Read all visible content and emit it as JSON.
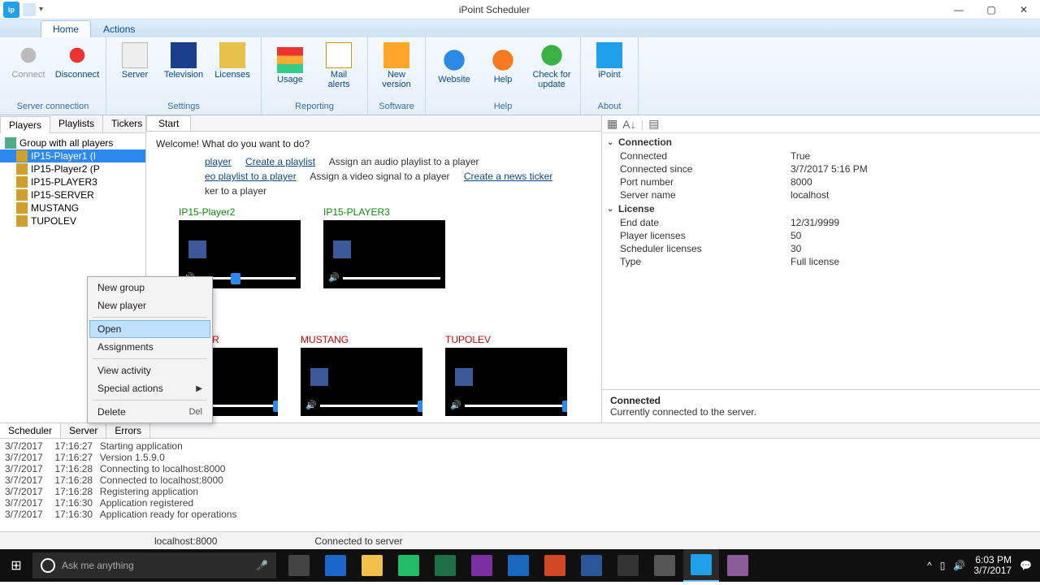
{
  "window": {
    "title": "iPoint Scheduler"
  },
  "tabs": {
    "home": "Home",
    "actions": "Actions"
  },
  "ribbon": {
    "groups": {
      "server_connection": {
        "label": "Server connection",
        "connect": "Connect",
        "disconnect": "Disconnect"
      },
      "settings": {
        "label": "Settings",
        "server": "Server",
        "television": "Television",
        "licenses": "Licenses"
      },
      "reporting": {
        "label": "Reporting",
        "usage": "Usage",
        "mail_alerts": "Mail\nalerts"
      },
      "software": {
        "label": "Software",
        "new_version": "New\nversion"
      },
      "help": {
        "label": "Help",
        "website": "Website",
        "help": "Help",
        "check_update": "Check for\nupdate"
      },
      "about": {
        "label": "About",
        "ipoint": "iPoint"
      }
    }
  },
  "left_tabs": {
    "players": "Players",
    "playlists": "Playlists",
    "tickers": "Tickers"
  },
  "tree": {
    "root": "Group with all players",
    "items": [
      "IP15-Player1 (I",
      "IP15-Player2 (P",
      "IP15-PLAYER3",
      "IP15-SERVER",
      "MUSTANG",
      "TUPOLEV"
    ]
  },
  "center_tab": "Start",
  "welcome": {
    "heading": "Welcome! What do you want to do?",
    "row1": {
      "link1": "player",
      "link2": "Create a playlist",
      "text3": "Assign an audio playlist to a player"
    },
    "row2": {
      "link1": "eo playlist to a player",
      "text2": "Assign a video signal to a player",
      "link3": "Create a news ticker"
    },
    "row3": {
      "text1": "ker to a player"
    }
  },
  "thumbs": [
    {
      "name": "IP15-Player2",
      "cls": "green",
      "knob": 40
    },
    {
      "name": "IP15-PLAYER3",
      "cls": "green",
      "knob": 130
    },
    {
      "name": "IP15-SERVER",
      "cls": "red",
      "knob": 120
    },
    {
      "name": "MUSTANG",
      "cls": "red",
      "knob": 120
    },
    {
      "name": "TUPOLEV",
      "cls": "red",
      "knob": 120
    }
  ],
  "context_menu": {
    "new_group": "New group",
    "new_player": "New player",
    "open": "Open",
    "assignments": "Assignments",
    "view_activity": "View activity",
    "special_actions": "Special actions",
    "delete": "Delete",
    "delete_sc": "Del"
  },
  "properties": {
    "toolbar_hint": "",
    "connection": {
      "cat": "Connection",
      "connected": {
        "k": "Connected",
        "v": "True"
      },
      "connected_since": {
        "k": "Connected since",
        "v": "3/7/2017 5:16 PM"
      },
      "port": {
        "k": "Port number",
        "v": "8000"
      },
      "server_name": {
        "k": "Server name",
        "v": "localhost"
      }
    },
    "license": {
      "cat": "License",
      "end_date": {
        "k": "End date",
        "v": "12/31/9999"
      },
      "player_licenses": {
        "k": "Player licenses",
        "v": "50"
      },
      "scheduler_licenses": {
        "k": "Scheduler licenses",
        "v": "30"
      },
      "type": {
        "k": "Type",
        "v": "Full license"
      }
    }
  },
  "right_status": {
    "title": "Connected",
    "msg": "Currently connected to the server."
  },
  "log_tabs": {
    "scheduler": "Scheduler",
    "server": "Server",
    "errors": "Errors"
  },
  "log": [
    {
      "d": "3/7/2017",
      "t": "17:16:27",
      "m": "Starting application"
    },
    {
      "d": "3/7/2017",
      "t": "17:16:27",
      "m": "Version 1.5.9.0"
    },
    {
      "d": "3/7/2017",
      "t": "17:16:28",
      "m": "Connecting to localhost:8000"
    },
    {
      "d": "3/7/2017",
      "t": "17:16:28",
      "m": "Connected to localhost:8000"
    },
    {
      "d": "3/7/2017",
      "t": "17:16:28",
      "m": "Registering application"
    },
    {
      "d": "3/7/2017",
      "t": "17:16:30",
      "m": "Application registered"
    },
    {
      "d": "3/7/2017",
      "t": "17:16:30",
      "m": "Application ready for operations"
    }
  ],
  "statusbar": {
    "host": "localhost:8000",
    "msg": "Connected to server"
  },
  "taskbar": {
    "search_placeholder": "Ask me anything",
    "clock_time": "6:03 PM",
    "clock_date": "3/7/2017"
  }
}
